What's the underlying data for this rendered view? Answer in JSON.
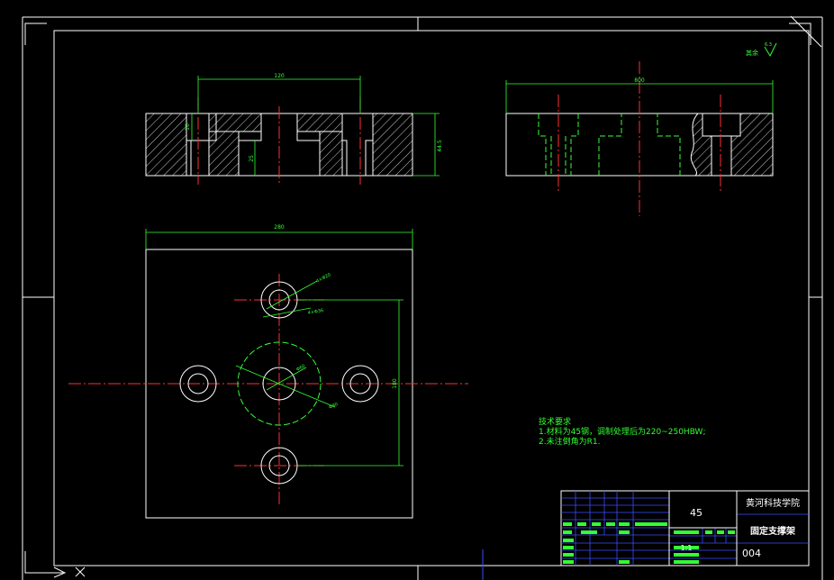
{
  "drawing": {
    "colors": {
      "background": "#000000",
      "outline": "#ffffff",
      "dimension": "#33ff33",
      "centerline": "#ff3030",
      "hidden": "#33ff33",
      "titleblock_grid": "#3a4dff"
    },
    "top_left_view": {
      "dim_width": "120",
      "dim_depth": "25",
      "dim_height": "44.5",
      "dim_small": "16"
    },
    "top_right_view": {
      "dim_width": "800"
    },
    "plan_view": {
      "dim_width": "280",
      "dim_vertical": "180",
      "leader_1": "4×Φ20",
      "leader_2": "4×Φ36",
      "leader_3": "Φ60",
      "leader_4": "Φ90"
    },
    "roughness": {
      "label": "其余",
      "value": "6.3"
    },
    "technical_requirements": {
      "heading": "技术要求",
      "line1": "1.材料为45钢，调制处理后为220~250HBW;",
      "line2": "2.未注倒角为R1."
    },
    "title_block": {
      "material": "45",
      "school": "黄河科技学院",
      "part_name": "固定支撑架",
      "drawing_no": "004",
      "scale": "1:1"
    }
  }
}
